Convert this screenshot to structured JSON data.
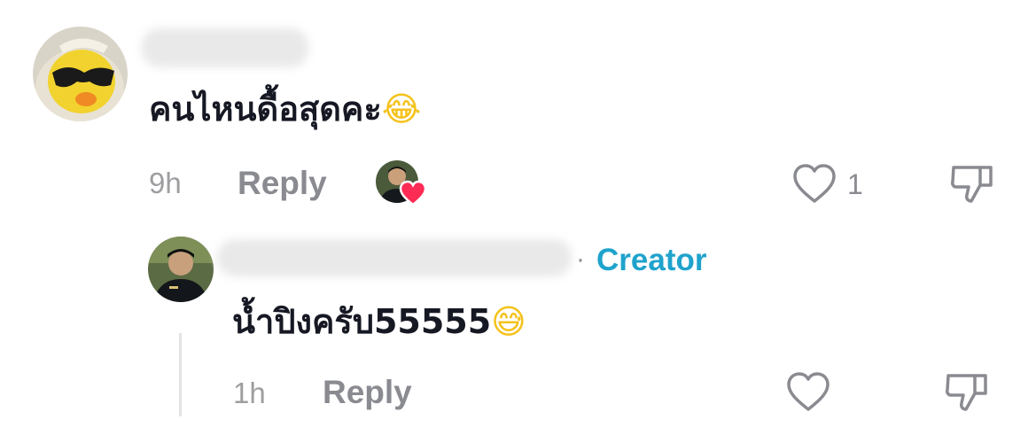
{
  "comment": {
    "text": "คนไหนดื้อสุดคะ",
    "emoji": "😂",
    "time": "9h",
    "reply_label": "Reply",
    "like_count": "1"
  },
  "reply": {
    "badge_separator": "·",
    "badge": "Creator",
    "text": "น้ำปิงครับ55555",
    "emoji": "😅",
    "time": "1h",
    "reply_label": "Reply"
  },
  "colors": {
    "text": "#161823",
    "muted": "#8a8b91",
    "creator": "#1fa3cc",
    "liked_heart": "#fe2c55"
  },
  "icons": {
    "like": "heart-outline-icon",
    "dislike": "thumbs-down-icon",
    "creator_liked": "heart-filled-icon"
  }
}
